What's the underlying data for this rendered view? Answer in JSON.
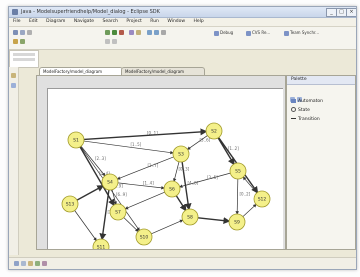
{
  "window": {
    "title": "Java - Modelsuperfriendhelp/Model_dialog - Eclipse SDK"
  },
  "titlebar": {
    "minimize": "_",
    "maximize": "□",
    "close": "×"
  },
  "menus": [
    "File",
    "Edit",
    "Diagram",
    "Navigate",
    "Search",
    "Project",
    "Run",
    "Window",
    "Help"
  ],
  "perspectives": [
    "Debug",
    "CVS Re...",
    "Team Synchr..."
  ],
  "tabs": [
    "ModelFactory/model_diagram",
    "ModelFactory/model_diagram"
  ],
  "palette": {
    "title": "Palette",
    "items": [
      {
        "label": "Automaton",
        "icon": "automaton-icon"
      },
      {
        "label": "State",
        "icon": "state-icon"
      },
      {
        "label": "Transition",
        "icon": "transition-icon"
      }
    ]
  },
  "diagram": {
    "nodes": [
      {
        "id": "n1",
        "label": "S1"
      },
      {
        "id": "n2",
        "label": "S2"
      },
      {
        "id": "n3",
        "label": "S3"
      },
      {
        "id": "n4",
        "label": "S4"
      },
      {
        "id": "n5",
        "label": "S5"
      },
      {
        "id": "n6",
        "label": "S6"
      },
      {
        "id": "n7",
        "label": "S7"
      },
      {
        "id": "n8",
        "label": "S8"
      },
      {
        "id": "n9",
        "label": "S9"
      },
      {
        "id": "n10",
        "label": "S10"
      },
      {
        "id": "n11",
        "label": "S11"
      },
      {
        "id": "n12",
        "label": "S12"
      },
      {
        "id": "n13",
        "label": "S13"
      }
    ],
    "edge_labels": [
      "[0..1]",
      "[1..5]",
      "[2..3]",
      "[0..4]",
      "[5..9]",
      "[3..6]",
      "[1..2]",
      "[2..7]",
      "[0..3]",
      "[4..8]",
      "[1..4]",
      "[6..9]",
      "[2..5]",
      "[0..2]",
      "[3..5]"
    ]
  },
  "colors": {
    "node_fill": "#f4f08a",
    "node_stroke": "#a19a2a",
    "edge": "#333333",
    "edge_label": "#666666"
  }
}
